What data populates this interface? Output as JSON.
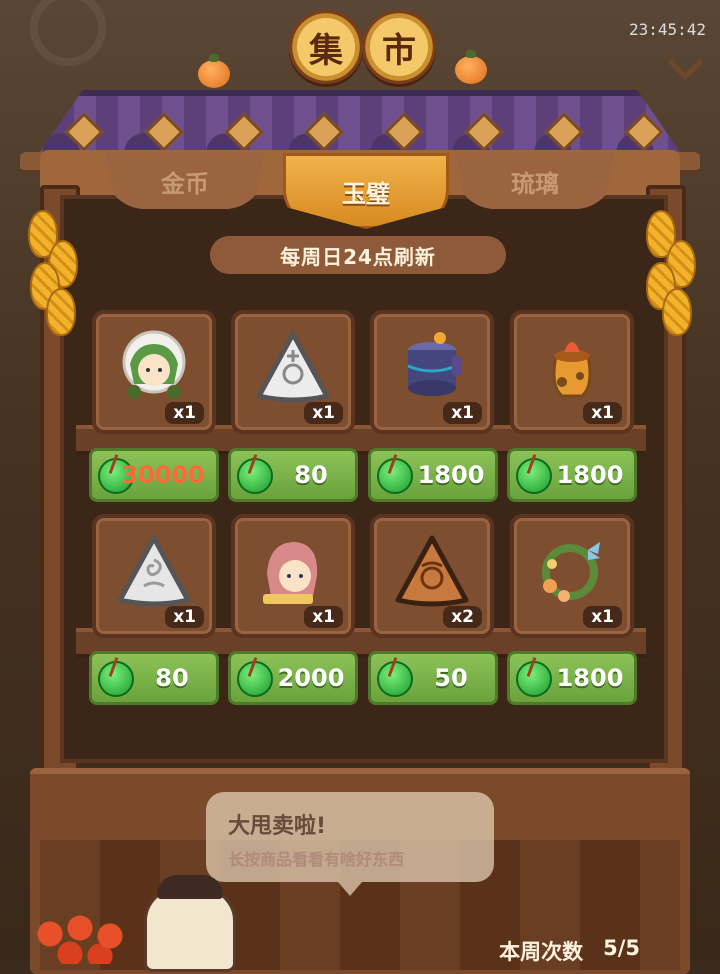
{
  "status": {
    "time": "23:45:42"
  },
  "title": {
    "char1": "集",
    "char2": "市"
  },
  "tabs": [
    {
      "label": "金币",
      "active": false
    },
    {
      "label": "玉璧",
      "active": true
    },
    {
      "label": "琉璃",
      "active": false
    }
  ],
  "refresh_notice": "每周日24点刷新",
  "items": [
    {
      "icon": "green-hair-character-icon",
      "qty": "x1",
      "price": "30000",
      "price_unavailable": true
    },
    {
      "icon": "white-jade-triangle-icon",
      "qty": "x1",
      "price": "80"
    },
    {
      "icon": "blue-cauldron-icon",
      "qty": "x1",
      "price": "1800"
    },
    {
      "icon": "orange-jar-icon",
      "qty": "x1",
      "price": "1800"
    },
    {
      "icon": "white-swirl-triangle-icon",
      "qty": "x1",
      "price": "80"
    },
    {
      "icon": "pink-hair-character-icon",
      "qty": "x1",
      "price": "2000"
    },
    {
      "icon": "orange-rune-triangle-icon",
      "qty": "x2",
      "price": "50"
    },
    {
      "icon": "flower-wreath-icon",
      "qty": "x1",
      "price": "1800"
    }
  ],
  "currency_icon": "green-jade-coin-icon",
  "speech": {
    "line1": "大甩卖啦!",
    "line2": "长按商品看看有啥好东西"
  },
  "weekly": {
    "label": "本周次数",
    "value": "5/5"
  },
  "colors": {
    "price_bg": "#7db34a",
    "accent": "#e8a035",
    "unavailable_price": "#ff6a3a"
  }
}
